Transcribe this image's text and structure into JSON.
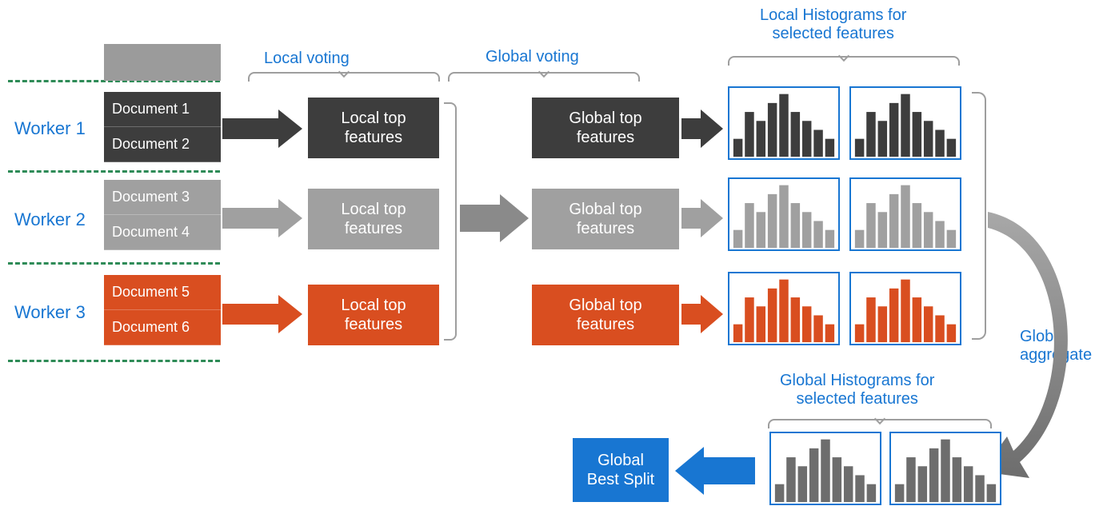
{
  "labels": {
    "local_voting": "Local voting",
    "global_voting": "Global voting",
    "local_hist_title": "Local Histograms for\nselected features",
    "global_hist_title": "Global Histograms for\nselected features",
    "global_aggregate": "Global\naggregate"
  },
  "workers": [
    "Worker 1",
    "Worker 2",
    "Worker 3"
  ],
  "documents": [
    "Document 1",
    "Document 2",
    "Document 3",
    "Document 4",
    "Document 5",
    "Document 6"
  ],
  "local_top": "Local top\nfeatures",
  "global_top": "Global top\nfeatures",
  "global_best_split": "Global\nBest Split",
  "colors": {
    "w1": "#3d3d3d",
    "w2": "#a0a0a0",
    "w3": "#d94e20",
    "blue": "#1876d2",
    "headgray": "#9b9b9b"
  },
  "chart_data": {
    "type": "bar",
    "histogram_values": [
      2,
      5,
      4,
      6,
      7,
      5,
      4,
      3,
      2
    ],
    "y_range": [
      0,
      7
    ],
    "note": "Same histogram shape repeated in all local/global histogram cells"
  }
}
